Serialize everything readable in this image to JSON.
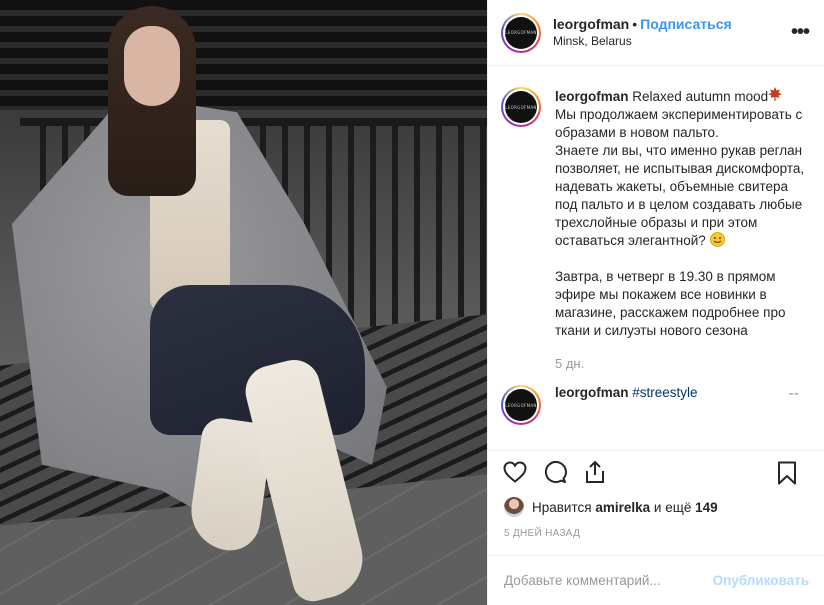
{
  "photo": {
    "alt_icon": "post-photo"
  },
  "header": {
    "username": "leorgofman",
    "separator": "•",
    "follow_label": "Подписаться",
    "location": "Minsk, Belarus",
    "more_label": "•••",
    "avatar_text": "LEORGOFMAN"
  },
  "caption": {
    "username": "leorgofman",
    "paragraph1": "Relaxed autumn mood",
    "leaf_icon": "maple-leaf-icon",
    "paragraph2": "Мы продолжаем экспериментировать с образами в новом пальто.\nЗнаете ли вы, что именно рукав реглан позволяет, не испытывая дискомфорта, надевать жакеты, объемные свитера под пальто и в целом создавать любые трехслойные образы и при этом оставаться элегантной?",
    "emoji_icon": "smiling-face-icon",
    "paragraph3": "Завтра, в четверг в 19.30 в прямом эфире мы покажем все новинки в магазине, расскажем подробнее про ткани и силуэты нового сезона",
    "time": "5 дн."
  },
  "comment2": {
    "username": "leorgofman",
    "text": "#streestyle",
    "trailing": "--"
  },
  "actions": {
    "like_icon": "heart-icon",
    "comment_icon": "comment-icon",
    "share_icon": "share-icon",
    "save_icon": "bookmark-icon"
  },
  "likes": {
    "prefix": "Нравится",
    "user": "amirelka",
    "middle": "и ещё",
    "count": "149"
  },
  "date": "5 ДНЕЙ НАЗАД",
  "add_comment": {
    "placeholder": "Добавьте комментарий...",
    "publish_label": "Опубликовать"
  },
  "colors": {
    "accent": "#3897f0",
    "publish_disabled": "#b3dbff",
    "muted": "#999999",
    "text": "#262626"
  }
}
